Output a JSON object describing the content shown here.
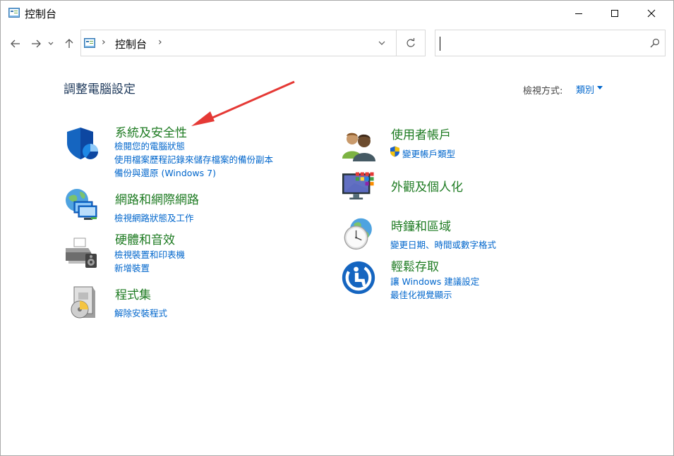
{
  "window": {
    "title": "控制台"
  },
  "address": {
    "path_item": "控制台",
    "separator": "›"
  },
  "search": {
    "value": "",
    "placeholder": ""
  },
  "header": {
    "title": "調整電腦設定",
    "view_by_label": "檢視方式:",
    "view_by_value": "類別"
  },
  "categories": [
    {
      "title": "系統及安全性",
      "icon": "security-shield-icon",
      "links": [
        "檢閱您的電腦狀態",
        "使用檔案歷程記錄來儲存檔案的備份副本",
        "備份與還原 (Windows 7)"
      ]
    },
    {
      "title": "網路和網際網路",
      "icon": "network-globe-icon",
      "links": [
        "檢視網路狀態及工作"
      ]
    },
    {
      "title": "硬體和音效",
      "icon": "printer-speaker-icon",
      "links": [
        "檢視裝置和印表機",
        "新增裝置"
      ]
    },
    {
      "title": "程式集",
      "icon": "programs-icon",
      "links": [
        "解除安裝程式"
      ]
    },
    {
      "title": "使用者帳戶",
      "icon": "users-icon",
      "links": [
        "變更帳戶類型"
      ]
    },
    {
      "title": "外觀及個人化",
      "icon": "monitor-icon",
      "links": []
    },
    {
      "title": "時鐘和區域",
      "icon": "clock-globe-icon",
      "links": [
        "變更日期、時間或數字格式"
      ]
    },
    {
      "title": "輕鬆存取",
      "icon": "ease-of-access-icon",
      "links": [
        "讓 Windows 建議設定",
        "最佳化視覺顯示"
      ]
    }
  ],
  "colors": {
    "link": "#0066cc",
    "category_title": "#1e7b22",
    "annotation_arrow": "#e53935"
  }
}
